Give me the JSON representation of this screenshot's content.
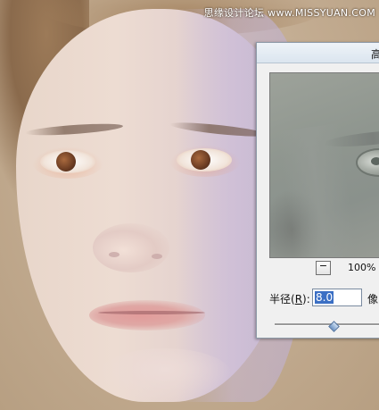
{
  "watermark": "思缘设计论坛 www.MISSYUAN.COM",
  "dialog": {
    "title": "高",
    "zoom": {
      "minus_symbol": "−",
      "level": "100%"
    },
    "radius": {
      "label_prefix": "半径(",
      "label_accel": "R",
      "label_suffix": "):",
      "value": "8.0",
      "unit": "像"
    },
    "slider": {
      "position_fraction": 0.5
    }
  },
  "colors": {
    "selection": "#3b6fc4",
    "dialog_bg": "#f0f0f0"
  }
}
